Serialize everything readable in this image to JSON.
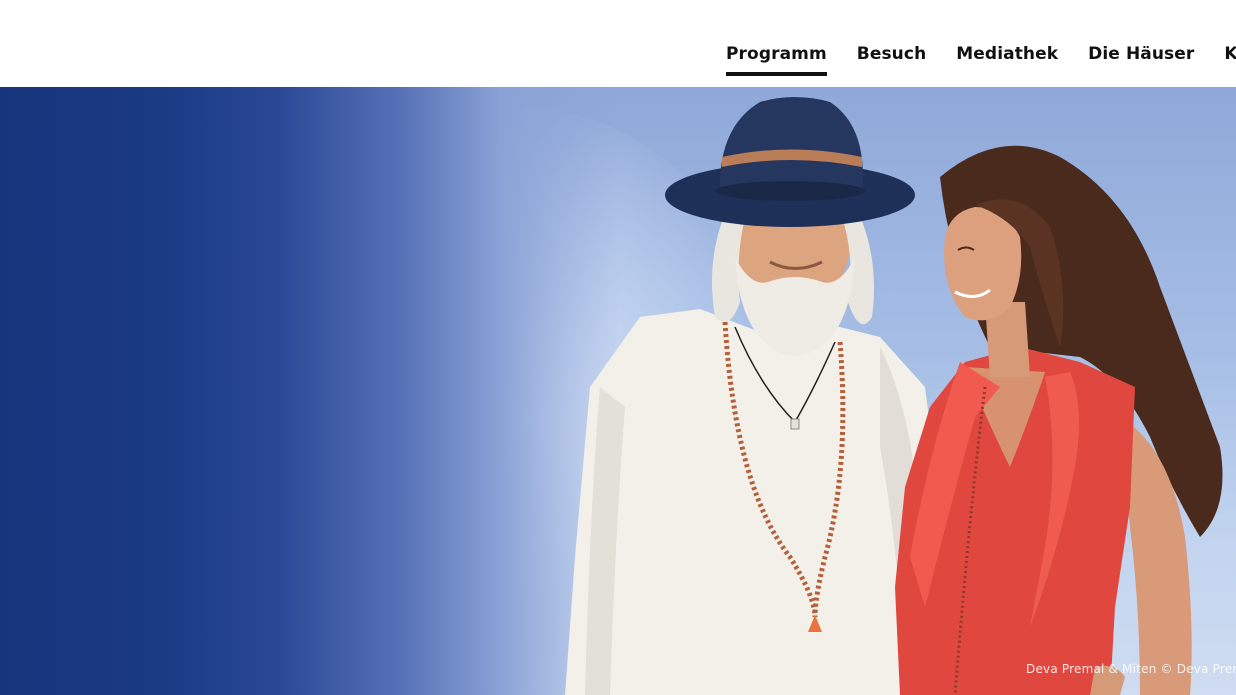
{
  "nav": {
    "items": [
      {
        "label": "Programm",
        "active": true
      },
      {
        "label": "Besuch",
        "active": false
      },
      {
        "label": "Mediathek",
        "active": false
      },
      {
        "label": "Die Häuser",
        "active": false
      },
      {
        "label": "Kinder &",
        "active": false
      }
    ]
  },
  "hero": {
    "photo_caption": "Deva Premal & Miten © Deva Prem",
    "colors": {
      "deep_blue": "#17357d",
      "sky_blue": "#a7bfe6",
      "dress_red": "#e0483f",
      "shirt_white": "#f4f1ec"
    }
  }
}
